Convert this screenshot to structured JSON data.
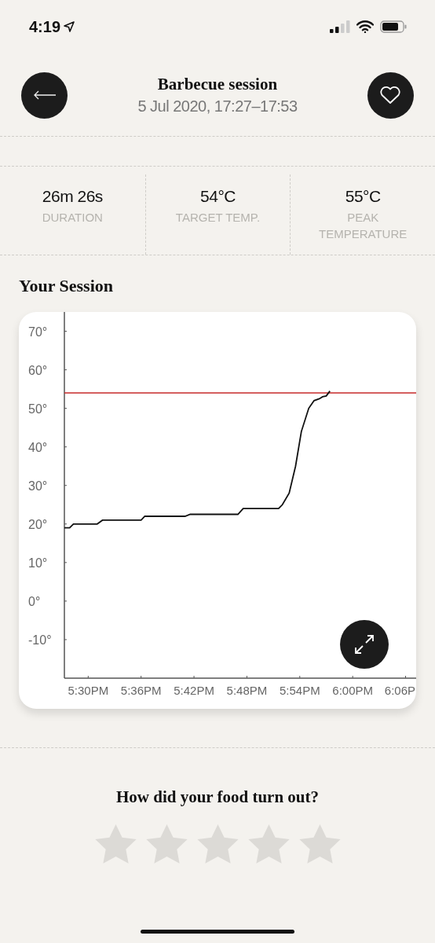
{
  "status_bar": {
    "time": "4:19"
  },
  "header": {
    "title": "Barbecue session",
    "subtitle": "5 Jul 2020, 17:27–17:53"
  },
  "stats": [
    {
      "value": "26m 26s",
      "label": "DURATION"
    },
    {
      "value": "54°C",
      "label": "TARGET TEMP."
    },
    {
      "value": "55°C",
      "label": "PEAK TEMPERATURE"
    }
  ],
  "session": {
    "heading": "Your Session",
    "chart_data": {
      "type": "line",
      "xlim": [
        17.455,
        18.12
      ],
      "ylim": [
        -20,
        75
      ],
      "x": [
        17.455,
        17.465,
        17.472,
        17.517,
        17.527,
        17.6,
        17.607,
        17.683,
        17.693,
        17.783,
        17.793,
        17.86,
        17.867,
        17.88,
        17.892,
        17.903,
        17.917,
        17.927,
        17.937,
        17.943,
        17.95,
        17.957
      ],
      "series": [
        {
          "color": "#111111",
          "values": [
            19,
            19,
            20,
            20,
            21,
            21,
            22,
            22,
            22.5,
            22.5,
            24,
            24,
            25,
            28,
            35,
            44,
            50,
            52,
            52.5,
            53,
            53.2,
            54.5
          ]
        }
      ],
      "xticks": [
        {
          "value": 17.5,
          "label": "5:30PM"
        },
        {
          "value": 17.6,
          "label": "5:36PM"
        },
        {
          "value": 17.7,
          "label": "5:42PM"
        },
        {
          "value": 17.8,
          "label": "5:48PM"
        },
        {
          "value": 17.9,
          "label": "5:54PM"
        },
        {
          "value": 18.0,
          "label": "6:00PM"
        },
        {
          "value": 18.1,
          "label": "6:06P"
        }
      ],
      "yticks": [
        {
          "value": 70,
          "label": "70°"
        },
        {
          "value": 60,
          "label": "60°"
        },
        {
          "value": 50,
          "label": "50°"
        },
        {
          "value": 40,
          "label": "40°"
        },
        {
          "value": 30,
          "label": "30°"
        },
        {
          "value": 20,
          "label": "20°"
        },
        {
          "value": 10,
          "label": "10°"
        },
        {
          "value": 0,
          "label": "0°"
        },
        {
          "value": -10,
          "label": "-10°"
        }
      ],
      "ref_lines": [
        {
          "axis": "y",
          "value": 54,
          "color": "#c62828"
        }
      ]
    }
  },
  "rating": {
    "question": "How did your food turn out?",
    "stars": 0
  }
}
